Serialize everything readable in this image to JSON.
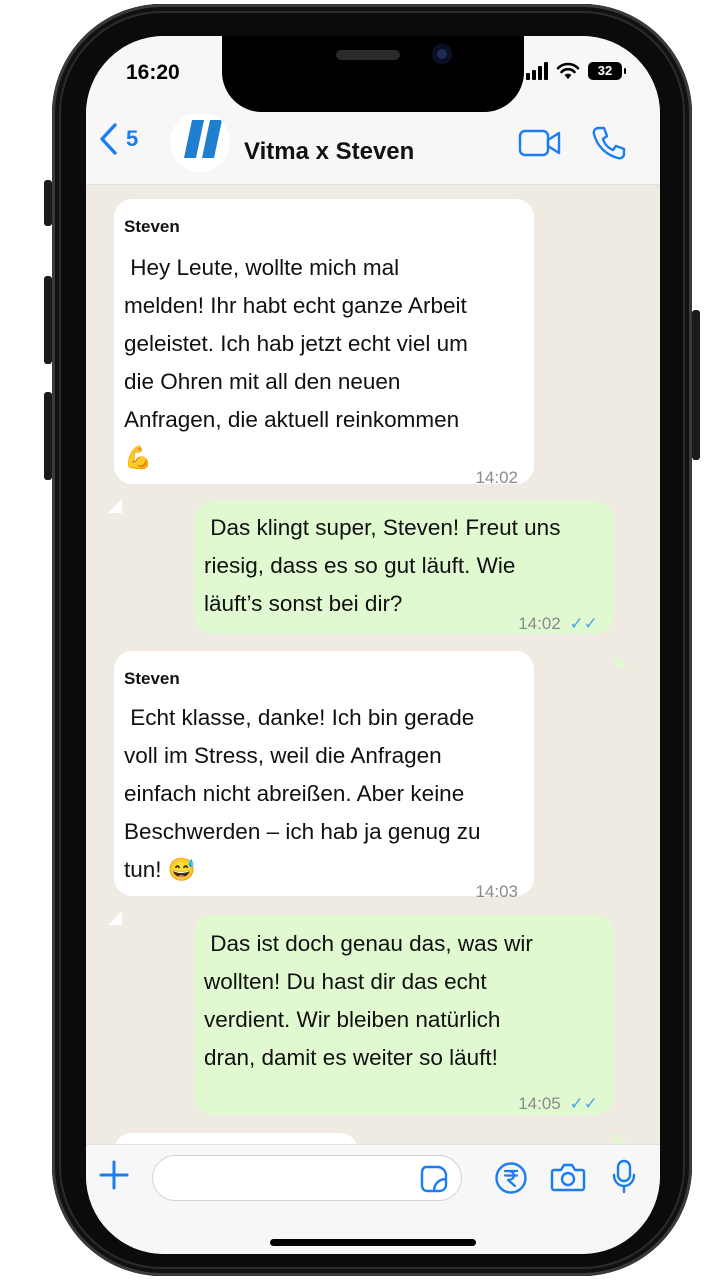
{
  "status_bar": {
    "time": "16:20",
    "battery": "32"
  },
  "header": {
    "back_count": "5",
    "title": "Vitma x Steven"
  },
  "messages": [
    {
      "direction": "incoming",
      "sender": "Steven",
      "text": " Hey Leute, wollte mich mal\nmelden! Ihr habt echt ganze Arbeit\ngeleistet. Ich hab jetzt echt viel um\ndie Ohren mit all den neuen\nAnfragen, die aktuell reinkommen\n💪",
      "time": "14:02"
    },
    {
      "direction": "outgoing",
      "text": " Das klingt super, Steven! Freut uns\nriesig, dass es so gut läuft. Wie\nläuft’s sonst bei dir?",
      "time": "14:02",
      "read_ticks": "✓✓"
    },
    {
      "direction": "incoming",
      "sender": "Steven",
      "text": " Echt klasse, danke! Ich bin gerade\nvoll im Stress, weil die Anfragen\neinfach nicht abreißen. Aber keine\nBeschwerden – ich hab ja genug zu\ntun! 😅",
      "time": "14:03"
    },
    {
      "direction": "outgoing",
      "text": " Das ist doch genau das, was wir\nwollten! Du hast dir das echt\nverdient. Wir bleiben natürlich\ndran, damit es weiter so läuft!",
      "time": "14:05",
      "read_ticks": "✓✓"
    }
  ],
  "input": {
    "value": "",
    "placeholder": ""
  },
  "colors": {
    "accent": "#1a7ef2",
    "outgoing_bubble": "#e1f9d1",
    "incoming_bubble": "#ffffff",
    "chat_background": "#efeae2",
    "read_ticks": "#48a6e8"
  },
  "icons": [
    "back-chevron-icon",
    "video-call-icon",
    "phone-call-icon",
    "plus-icon",
    "sticker-icon",
    "payment-icon",
    "camera-icon",
    "microphone-icon"
  ]
}
